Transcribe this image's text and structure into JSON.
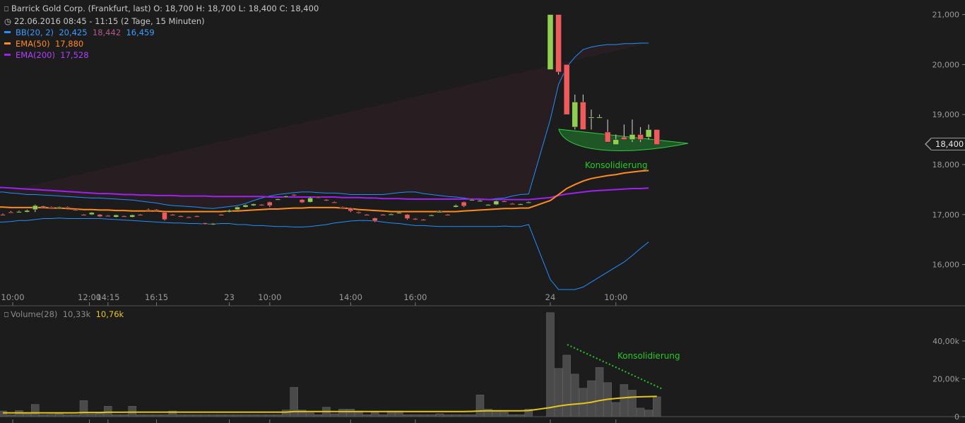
{
  "header": {
    "title_line": "Barrick Gold Corp. (Frankfurt, last)  O: 18,700  H: 18,700  L: 18,400  C: 18,400",
    "date_line": "22.06.2016 08:45 - 11:15 (2 Tage, 15 Minuten)"
  },
  "legend": {
    "bb_label": "BB(20, 2)",
    "bb_upper": "20,425",
    "bb_mid": "18,442",
    "bb_lower": "16,459",
    "ema50_label": "EMA(50)",
    "ema50_value": "17,880",
    "ema200_label": "EMA(200)",
    "ema200_value": "17,528",
    "volume_label": "Volume(28)",
    "volume_avg": "10,33k",
    "volume_value": "10,76k"
  },
  "price_tag": "18,400",
  "annotations": {
    "price_consolidation": "Konsolidierung",
    "volume_consolidation": "Konsolidierung"
  },
  "colors": {
    "background": "#1c1c1c",
    "up_candle": "#8fd14f",
    "down_candle": "#f05a5a",
    "bollinger": "#1e90ff",
    "ema50": "#ff8c1a",
    "ema200": "#a020f0",
    "volume_bar": "#4a4a4a",
    "volume_avg": "#e6c619",
    "annotation": "#22cc22"
  },
  "chart_data": [
    {
      "type": "candlestick",
      "x_tick_labels": [
        "10:00",
        "12:00",
        "14:15",
        "16:15",
        "23",
        "10:00",
        "14:00",
        "16:00",
        "24",
        "10:00"
      ],
      "y_tick_labels": [
        "21,000",
        "20,000",
        "19,000",
        "18,000",
        "17,000",
        "16,000"
      ],
      "y_ticks": [
        21000,
        20000,
        19000,
        18000,
        17000,
        16000
      ],
      "ylim": [
        15500,
        21150
      ],
      "candles": [
        {
          "o": 17.0,
          "h": 17.02,
          "l": 16.98,
          "c": 16.99
        },
        {
          "o": 17.05,
          "h": 17.07,
          "l": 17.03,
          "c": 17.04
        },
        {
          "o": 17.05,
          "h": 17.08,
          "l": 17.04,
          "c": 17.06
        },
        {
          "o": 17.05,
          "h": 17.1,
          "l": 17.04,
          "c": 17.08
        },
        {
          "o": 17.1,
          "h": 17.2,
          "l": 17.05,
          "c": 17.18
        },
        {
          "o": 17.17,
          "h": 17.18,
          "l": 17.13,
          "c": 17.15
        },
        {
          "o": 17.15,
          "h": 17.16,
          "l": 17.13,
          "c": 17.14
        },
        {
          "o": 17.14,
          "h": 17.16,
          "l": 17.12,
          "c": 17.15
        },
        {
          "o": 17.15,
          "h": 17.16,
          "l": 17.12,
          "c": 17.14
        },
        {
          "o": 17.1,
          "h": 17.11,
          "l": 17.08,
          "c": 17.09
        },
        {
          "o": 17.0,
          "h": 17.01,
          "l": 16.98,
          "c": 16.99
        },
        {
          "o": 17.0,
          "h": 17.05,
          "l": 16.99,
          "c": 17.04
        },
        {
          "o": 17.0,
          "h": 17.01,
          "l": 16.95,
          "c": 16.96
        },
        {
          "o": 16.98,
          "h": 16.99,
          "l": 16.96,
          "c": 16.97
        },
        {
          "o": 16.95,
          "h": 17.0,
          "l": 16.94,
          "c": 16.99
        },
        {
          "o": 16.97,
          "h": 16.98,
          "l": 16.95,
          "c": 16.96
        },
        {
          "o": 16.95,
          "h": 17.0,
          "l": 16.94,
          "c": 16.99
        },
        {
          "o": 17.0,
          "h": 17.01,
          "l": 16.98,
          "c": 16.99
        },
        {
          "o": 17.1,
          "h": 17.12,
          "l": 17.08,
          "c": 17.09
        },
        {
          "o": 17.1,
          "h": 17.11,
          "l": 17.08,
          "c": 17.09
        },
        {
          "o": 17.05,
          "h": 17.06,
          "l": 16.88,
          "c": 16.9
        },
        {
          "o": 17.0,
          "h": 17.01,
          "l": 16.98,
          "c": 16.99
        },
        {
          "o": 16.97,
          "h": 16.98,
          "l": 16.95,
          "c": 16.96
        },
        {
          "o": 16.95,
          "h": 16.96,
          "l": 16.93,
          "c": 16.94
        },
        {
          "o": 16.97,
          "h": 16.98,
          "l": 16.95,
          "c": 16.96
        },
        {
          "o": 16.83,
          "h": 16.84,
          "l": 16.8,
          "c": 16.82
        },
        {
          "o": 16.8,
          "h": 16.83,
          "l": 16.79,
          "c": 16.82
        },
        {
          "o": 17.0,
          "h": 17.01,
          "l": 16.98,
          "c": 16.99
        },
        {
          "o": 17.05,
          "h": 17.1,
          "l": 17.04,
          "c": 17.08
        },
        {
          "o": 17.1,
          "h": 17.16,
          "l": 17.09,
          "c": 17.15
        },
        {
          "o": 17.15,
          "h": 17.2,
          "l": 17.14,
          "c": 17.19
        },
        {
          "o": 17.18,
          "h": 17.22,
          "l": 17.17,
          "c": 17.21
        },
        {
          "o": 17.2,
          "h": 17.21,
          "l": 17.18,
          "c": 17.19
        },
        {
          "o": 17.25,
          "h": 17.26,
          "l": 17.15,
          "c": 17.18
        },
        {
          "o": 17.3,
          "h": 17.32,
          "l": 17.29,
          "c": 17.31
        },
        {
          "o": 17.35,
          "h": 17.38,
          "l": 17.34,
          "c": 17.37
        },
        {
          "o": 17.4,
          "h": 17.41,
          "l": 17.37,
          "c": 17.38
        },
        {
          "o": 17.3,
          "h": 17.31,
          "l": 17.23,
          "c": 17.24
        },
        {
          "o": 17.25,
          "h": 17.35,
          "l": 17.24,
          "c": 17.33
        },
        {
          "o": 17.35,
          "h": 17.36,
          "l": 17.33,
          "c": 17.34
        },
        {
          "o": 17.3,
          "h": 17.31,
          "l": 17.27,
          "c": 17.28
        },
        {
          "o": 17.25,
          "h": 17.26,
          "l": 17.23,
          "c": 17.24
        },
        {
          "o": 17.15,
          "h": 17.16,
          "l": 17.13,
          "c": 17.14
        },
        {
          "o": 17.13,
          "h": 17.14,
          "l": 17.05,
          "c": 17.07
        },
        {
          "o": 17.05,
          "h": 17.06,
          "l": 17.02,
          "c": 17.03
        },
        {
          "o": 17.0,
          "h": 17.01,
          "l": 16.98,
          "c": 16.99
        },
        {
          "o": 16.93,
          "h": 16.94,
          "l": 16.85,
          "c": 16.87
        },
        {
          "o": 17.0,
          "h": 17.01,
          "l": 16.98,
          "c": 16.99
        },
        {
          "o": 17.0,
          "h": 17.02,
          "l": 16.99,
          "c": 17.01
        },
        {
          "o": 17.03,
          "h": 17.05,
          "l": 17.02,
          "c": 17.04
        },
        {
          "o": 17.0,
          "h": 17.01,
          "l": 16.9,
          "c": 16.92
        },
        {
          "o": 16.92,
          "h": 16.93,
          "l": 16.89,
          "c": 16.91
        },
        {
          "o": 16.9,
          "h": 16.91,
          "l": 16.88,
          "c": 16.89
        },
        {
          "o": 16.98,
          "h": 17.0,
          "l": 16.97,
          "c": 16.99
        },
        {
          "o": 17.05,
          "h": 17.08,
          "l": 17.04,
          "c": 17.06
        },
        {
          "o": 17.0,
          "h": 17.01,
          "l": 16.98,
          "c": 16.99
        },
        {
          "o": 17.15,
          "h": 17.2,
          "l": 17.14,
          "c": 17.18
        },
        {
          "o": 17.25,
          "h": 17.26,
          "l": 17.15,
          "c": 17.17
        },
        {
          "o": 17.3,
          "h": 17.31,
          "l": 17.29,
          "c": 17.3
        },
        {
          "o": 17.28,
          "h": 17.29,
          "l": 17.27,
          "c": 17.28
        },
        {
          "o": 17.2,
          "h": 17.21,
          "l": 17.19,
          "c": 17.2
        },
        {
          "o": 17.2,
          "h": 17.28,
          "l": 17.19,
          "c": 17.27
        },
        {
          "o": 17.27,
          "h": 17.28,
          "l": 17.25,
          "c": 17.26
        },
        {
          "o": 17.22,
          "h": 17.23,
          "l": 17.2,
          "c": 17.21
        },
        {
          "o": 17.2,
          "h": 17.22,
          "l": 17.19,
          "c": 17.21
        },
        {
          "o": 17.25,
          "h": 17.26,
          "l": 17.24,
          "c": 17.25
        },
        {
          "o": 19.9,
          "h": 21.0,
          "l": 19.9,
          "c": 21.0
        },
        {
          "o": 21.0,
          "h": 21.0,
          "l": 19.8,
          "c": 19.85
        },
        {
          "o": 20.0,
          "h": 20.0,
          "l": 19.0,
          "c": 19.0
        },
        {
          "o": 18.75,
          "h": 19.4,
          "l": 18.7,
          "c": 19.25
        },
        {
          "o": 19.25,
          "h": 19.4,
          "l": 18.7,
          "c": 18.7
        },
        {
          "o": 18.95,
          "h": 19.1,
          "l": 18.7,
          "c": 18.95
        },
        {
          "o": 18.95,
          "h": 19.0,
          "l": 18.95,
          "c": 18.95
        },
        {
          "o": 18.65,
          "h": 18.9,
          "l": 18.45,
          "c": 18.45
        },
        {
          "o": 18.4,
          "h": 18.6,
          "l": 18.4,
          "c": 18.5
        },
        {
          "o": 18.55,
          "h": 18.8,
          "l": 18.5,
          "c": 18.5
        },
        {
          "o": 18.5,
          "h": 18.9,
          "l": 18.45,
          "c": 18.6
        },
        {
          "o": 18.6,
          "h": 18.75,
          "l": 18.45,
          "c": 18.5
        },
        {
          "o": 18.55,
          "h": 18.8,
          "l": 18.5,
          "c": 18.7
        },
        {
          "o": 18.7,
          "h": 18.7,
          "l": 18.4,
          "c": 18.4
        }
      ],
      "bollinger_upper": [
        17.45,
        17.43,
        17.42,
        17.4,
        17.4,
        17.39,
        17.38,
        17.37,
        17.36,
        17.35,
        17.34,
        17.33,
        17.33,
        17.32,
        17.31,
        17.3,
        17.29,
        17.27,
        17.25,
        17.23,
        17.2,
        17.18,
        17.17,
        17.16,
        17.15,
        17.13,
        17.12,
        17.14,
        17.16,
        17.18,
        17.22,
        17.28,
        17.33,
        17.37,
        17.4,
        17.42,
        17.44,
        17.45,
        17.45,
        17.44,
        17.43,
        17.43,
        17.42,
        17.4,
        17.4,
        17.4,
        17.4,
        17.4,
        17.42,
        17.44,
        17.45,
        17.45,
        17.42,
        17.4,
        17.38,
        17.36,
        17.35,
        17.33,
        17.31,
        17.3,
        17.3,
        17.32,
        17.33,
        17.37,
        17.4,
        17.41,
        18.9,
        19.6,
        19.95,
        20.15,
        20.3,
        20.35,
        20.38,
        20.4,
        20.4,
        20.42,
        20.42,
        20.43,
        20.43
      ],
      "bollinger_lower": [
        16.85,
        16.86,
        16.88,
        16.88,
        16.9,
        16.92,
        16.92,
        16.93,
        16.92,
        16.92,
        16.92,
        16.92,
        16.92,
        16.91,
        16.9,
        16.89,
        16.88,
        16.87,
        16.86,
        16.85,
        16.84,
        16.83,
        16.83,
        16.82,
        16.82,
        16.81,
        16.81,
        16.82,
        16.82,
        16.8,
        16.8,
        16.78,
        16.78,
        16.77,
        16.76,
        16.76,
        16.75,
        16.75,
        16.76,
        16.78,
        16.8,
        16.83,
        16.85,
        16.87,
        16.88,
        16.88,
        16.87,
        16.85,
        16.83,
        16.82,
        16.8,
        16.78,
        16.78,
        16.77,
        16.76,
        16.76,
        16.76,
        16.76,
        16.76,
        16.76,
        16.76,
        16.76,
        16.77,
        16.76,
        16.76,
        16.8,
        15.7,
        15.5,
        15.5,
        15.5,
        15.55,
        15.65,
        15.75,
        15.85,
        15.95,
        16.05,
        16.18,
        16.32,
        16.45
      ],
      "ema50": [
        17.15,
        17.14,
        17.14,
        17.14,
        17.14,
        17.14,
        17.13,
        17.13,
        17.12,
        17.11,
        17.1,
        17.1,
        17.09,
        17.09,
        17.08,
        17.08,
        17.07,
        17.07,
        17.07,
        17.07,
        17.06,
        17.06,
        17.06,
        17.06,
        17.06,
        17.06,
        17.06,
        17.06,
        17.07,
        17.07,
        17.08,
        17.09,
        17.1,
        17.11,
        17.11,
        17.12,
        17.13,
        17.13,
        17.14,
        17.14,
        17.14,
        17.14,
        17.13,
        17.12,
        17.1,
        17.09,
        17.08,
        17.07,
        17.06,
        17.06,
        17.06,
        17.06,
        17.06,
        17.06,
        17.06,
        17.06,
        17.06,
        17.07,
        17.08,
        17.09,
        17.1,
        17.11,
        17.12,
        17.12,
        17.13,
        17.13,
        17.28,
        17.4,
        17.52,
        17.6,
        17.67,
        17.72,
        17.75,
        17.78,
        17.8,
        17.83,
        17.85,
        17.87,
        17.88
      ],
      "ema200": [
        17.54,
        17.53,
        17.52,
        17.51,
        17.5,
        17.49,
        17.48,
        17.47,
        17.46,
        17.45,
        17.44,
        17.43,
        17.42,
        17.42,
        17.41,
        17.4,
        17.4,
        17.39,
        17.39,
        17.38,
        17.38,
        17.38,
        17.37,
        17.37,
        17.37,
        17.37,
        17.36,
        17.36,
        17.36,
        17.36,
        17.36,
        17.36,
        17.36,
        17.35,
        17.35,
        17.35,
        17.35,
        17.35,
        17.35,
        17.35,
        17.35,
        17.35,
        17.34,
        17.34,
        17.34,
        17.33,
        17.33,
        17.32,
        17.32,
        17.32,
        17.31,
        17.31,
        17.31,
        17.31,
        17.31,
        17.31,
        17.31,
        17.31,
        17.31,
        17.31,
        17.3,
        17.3,
        17.3,
        17.3,
        17.3,
        17.3,
        17.34,
        17.38,
        17.41,
        17.43,
        17.45,
        17.47,
        17.48,
        17.49,
        17.5,
        17.51,
        17.52,
        17.52,
        17.53
      ]
    },
    {
      "type": "bar",
      "title": "Volume(28)",
      "y_tick_labels": [
        "40,00k",
        "20,00k",
        "0"
      ],
      "y_ticks": [
        40000,
        20000,
        0
      ],
      "ylim": [
        0,
        56000
      ],
      "values": [
        3000,
        1000,
        3200,
        1500,
        6500,
        1000,
        1200,
        1500,
        1000,
        1000,
        8500,
        1500,
        1800,
        5500,
        1000,
        1000,
        5500,
        1000,
        1000,
        1000,
        1000,
        3000,
        1000,
        1000,
        1000,
        1000,
        1000,
        1000,
        1000,
        1000,
        1000,
        1000,
        1000,
        1000,
        1000,
        3500,
        15500,
        3500,
        2000,
        1000,
        5000,
        1500,
        4000,
        4000,
        3000,
        1000,
        2500,
        1000,
        3000,
        3000,
        1000,
        1000,
        1000,
        1000,
        1500,
        1000,
        1000,
        1000,
        1000,
        11500,
        4000,
        3000,
        2500,
        1000,
        1000,
        4000,
        55000,
        25500,
        32500,
        22500,
        15000,
        19000,
        26000,
        18000,
        7500,
        17000,
        14000,
        4500,
        3500,
        10500
      ],
      "average": [
        2000,
        2000,
        2000,
        2000,
        2000,
        2000,
        2000,
        2000,
        2000,
        2000,
        2200,
        2200,
        2200,
        2300,
        2300,
        2300,
        2400,
        2400,
        2400,
        2400,
        2400,
        2400,
        2400,
        2400,
        2400,
        2400,
        2400,
        2400,
        2400,
        2400,
        2400,
        2400,
        2400,
        2400,
        2400,
        2400,
        2700,
        2700,
        2700,
        2700,
        2700,
        2700,
        2700,
        2700,
        2700,
        2700,
        2700,
        2700,
        2700,
        2700,
        2700,
        2700,
        2700,
        2700,
        2700,
        2700,
        2700,
        2700,
        2800,
        3000,
        3100,
        3100,
        3100,
        3100,
        3100,
        3200,
        4800,
        5600,
        6200,
        6600,
        7000,
        7600,
        8500,
        9200,
        9600,
        10000,
        10300,
        10500,
        10600,
        10760
      ]
    }
  ]
}
